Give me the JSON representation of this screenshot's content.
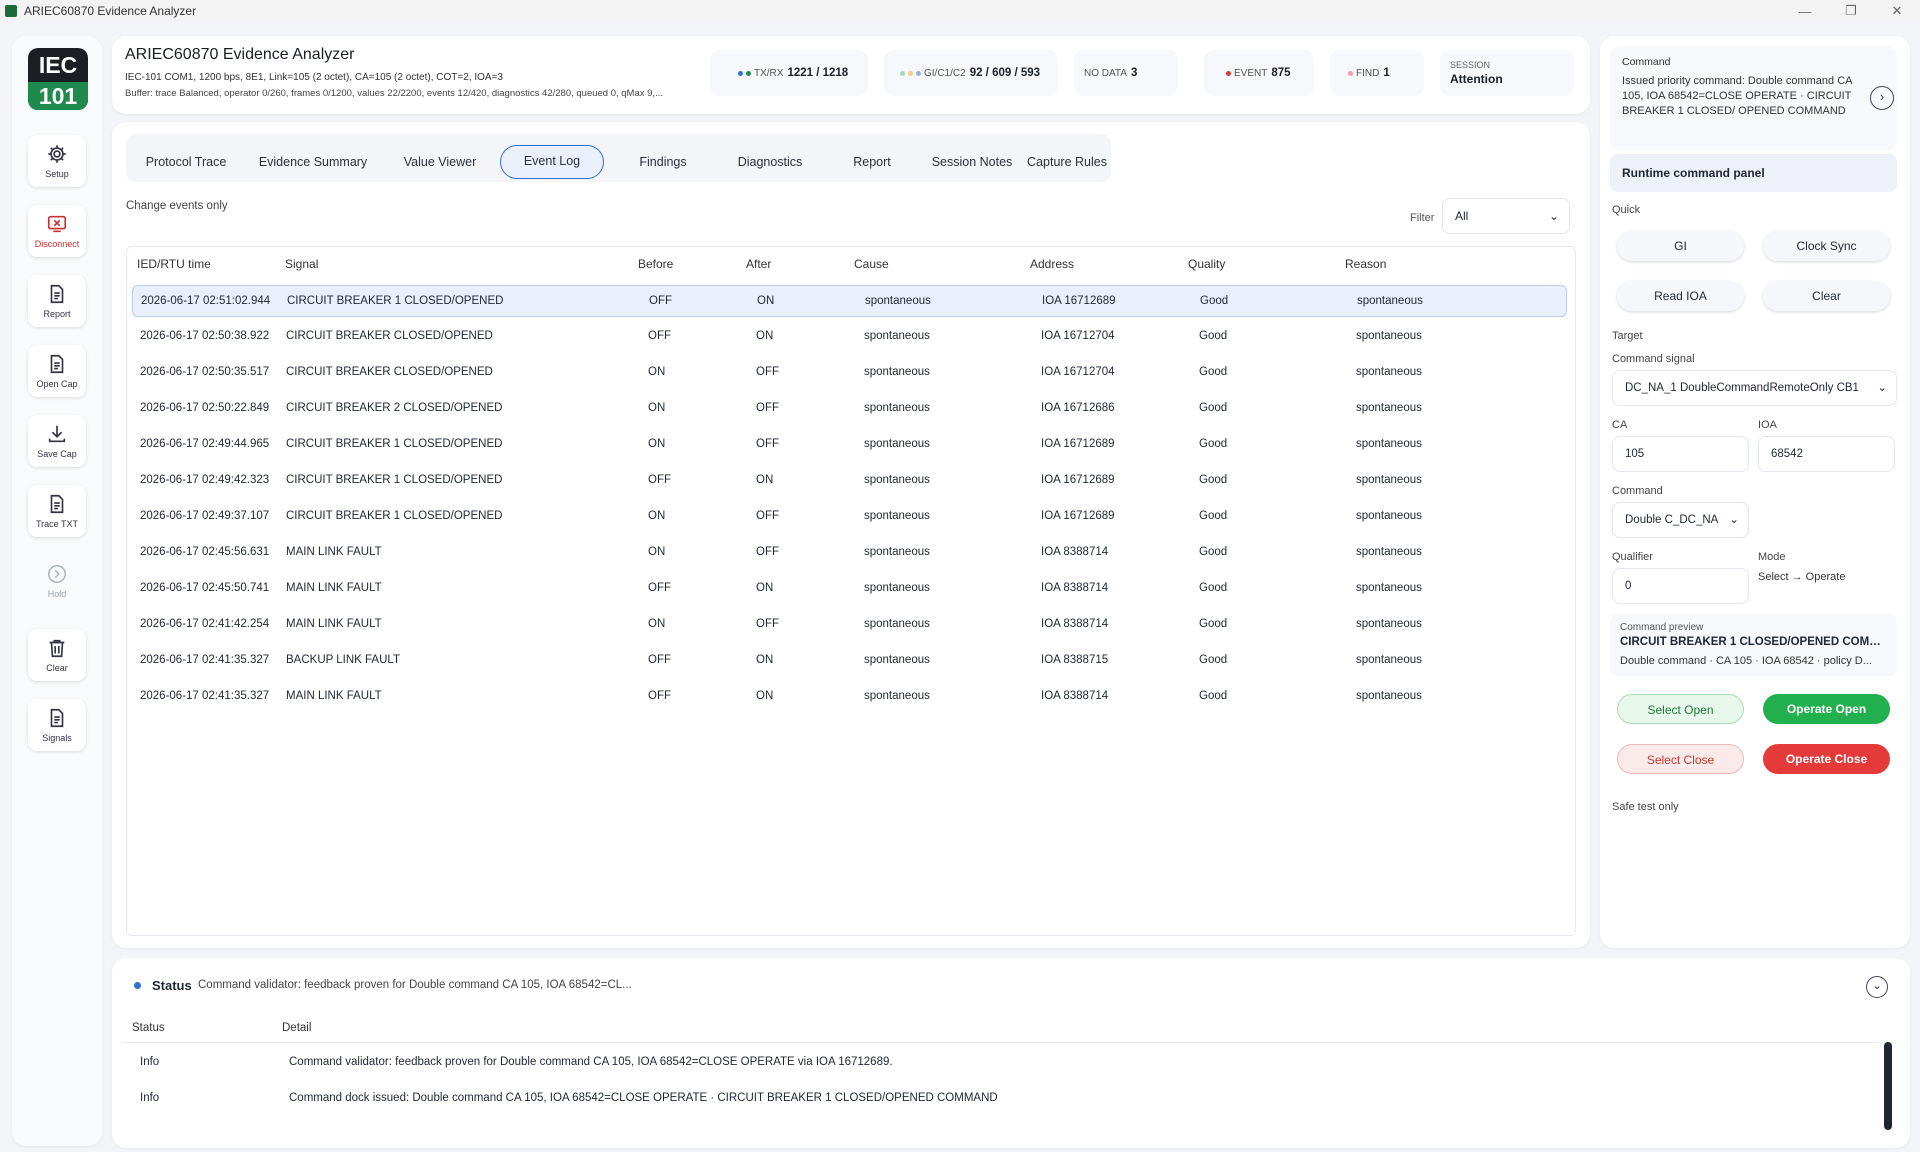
{
  "window": {
    "title": "ARIEC60870 Evidence Analyzer"
  },
  "rail": {
    "logo_top": "IEC",
    "logo_bottom": "101",
    "items": [
      {
        "label": "Setup",
        "icon": "gear-icon"
      },
      {
        "label": "Disconnect",
        "icon": "disconnect-icon"
      },
      {
        "label": "Report",
        "icon": "document-icon"
      },
      {
        "label": "Open Cap",
        "icon": "document-icon"
      },
      {
        "label": "Save Cap",
        "icon": "download-icon"
      },
      {
        "label": "Trace TXT",
        "icon": "document-icon"
      },
      {
        "label": "Hold",
        "icon": "chevron-right-icon"
      },
      {
        "label": "Clear",
        "icon": "trash-icon"
      },
      {
        "label": "Signals",
        "icon": "document-icon"
      }
    ]
  },
  "header": {
    "title": "ARIEC60870 Evidence Analyzer",
    "line1": "IEC-101 COM1, 1200 bps, 8E1, Link=105 (2 octet), CA=105 (2 octet), COT=2, IOA=3",
    "line2": "Buffer: trace Balanced, operator 0/260, frames 0/1200, values 22/2200, events 12/420, diagnostics 42/280, queued 0, qMax 9,...",
    "txrx_label": "TX/RX",
    "txrx_value": "1221 / 1218",
    "gi_label": "GI/C1/C2",
    "gi_value": "92 / 609 / 593",
    "nodata_label": "NO DATA",
    "nodata_value": "3",
    "event_label": "EVENT",
    "event_value": "875",
    "find_label": "FIND",
    "find_value": "1",
    "session_label": "SESSION",
    "session_value": "Attention"
  },
  "tabs": [
    "Protocol Trace",
    "Evidence Summary",
    "Value Viewer",
    "Event Log",
    "Findings",
    "Diagnostics",
    "Report",
    "Session Notes",
    "Capture Rules"
  ],
  "active_tab": "Event Log",
  "event_log": {
    "subtitle": "Change events only",
    "filter_label": "Filter",
    "filter_value": "All",
    "columns": [
      "IED/RTU time",
      "Signal",
      "Before",
      "After",
      "Cause",
      "Address",
      "Quality",
      "Reason"
    ],
    "rows": [
      [
        "2026-06-17 02:51:02.944",
        "CIRCUIT BREAKER 1 CLOSED/OPENED",
        "OFF",
        "ON",
        "spontaneous",
        "IOA 16712689",
        "Good",
        "spontaneous"
      ],
      [
        "2026-06-17 02:50:38.922",
        "CIRCUIT BREAKER CLOSED/OPENED",
        "OFF",
        "ON",
        "spontaneous",
        "IOA 16712704",
        "Good",
        "spontaneous"
      ],
      [
        "2026-06-17 02:50:35.517",
        "CIRCUIT BREAKER CLOSED/OPENED",
        "ON",
        "OFF",
        "spontaneous",
        "IOA 16712704",
        "Good",
        "spontaneous"
      ],
      [
        "2026-06-17 02:50:22.849",
        "CIRCUIT BREAKER 2 CLOSED/OPENED",
        "ON",
        "OFF",
        "spontaneous",
        "IOA 16712686",
        "Good",
        "spontaneous"
      ],
      [
        "2026-06-17 02:49:44.965",
        "CIRCUIT BREAKER 1 CLOSED/OPENED",
        "ON",
        "OFF",
        "spontaneous",
        "IOA 16712689",
        "Good",
        "spontaneous"
      ],
      [
        "2026-06-17 02:49:42.323",
        "CIRCUIT BREAKER 1 CLOSED/OPENED",
        "OFF",
        "ON",
        "spontaneous",
        "IOA 16712689",
        "Good",
        "spontaneous"
      ],
      [
        "2026-06-17 02:49:37.107",
        "CIRCUIT BREAKER 1 CLOSED/OPENED",
        "ON",
        "OFF",
        "spontaneous",
        "IOA 16712689",
        "Good",
        "spontaneous"
      ],
      [
        "2026-06-17 02:45:56.631",
        "MAIN LINK FAULT",
        "ON",
        "OFF",
        "spontaneous",
        "IOA 8388714",
        "Good",
        "spontaneous"
      ],
      [
        "2026-06-17 02:45:50.741",
        "MAIN LINK FAULT",
        "OFF",
        "ON",
        "spontaneous",
        "IOA 8388714",
        "Good",
        "spontaneous"
      ],
      [
        "2026-06-17 02:41:42.254",
        "MAIN LINK FAULT",
        "ON",
        "OFF",
        "spontaneous",
        "IOA 8388714",
        "Good",
        "spontaneous"
      ],
      [
        "2026-06-17 02:41:35.327",
        "BACKUP LINK FAULT",
        "OFF",
        "ON",
        "spontaneous",
        "IOA 8388715",
        "Good",
        "spontaneous"
      ],
      [
        "2026-06-17 02:41:35.327",
        "MAIN LINK FAULT",
        "OFF",
        "ON",
        "spontaneous",
        "IOA 8388714",
        "Good",
        "spontaneous"
      ]
    ]
  },
  "command_panel": {
    "card_label": "Command",
    "card_text": "Issued priority command: Double command CA 105, IOA 68542=CLOSE OPERATE · CIRCUIT BREAKER 1 CLOSED/ OPENED COMMAND",
    "runtime_label": "Runtime command panel",
    "quick_label": "Quick",
    "quick": [
      "GI",
      "Clock Sync",
      "Read IOA",
      "Clear"
    ],
    "target_label": "Target",
    "signal_label": "Command signal",
    "signal_value": "DC_NA_1 DoubleCommandRemoteOnly CB1",
    "ca_label": "CA",
    "ca_value": "105",
    "ioa_label": "IOA",
    "ioa_value": "68542",
    "command_label": "Command",
    "command_value": "Double C_DC_NA",
    "qualifier_label": "Qualifier",
    "qualifier_value": "0",
    "mode_label": "Mode",
    "mode_value": "Select → Operate",
    "preview_label": "Command preview",
    "preview_title": "CIRCUIT BREAKER 1 CLOSED/OPENED COMMA...",
    "preview_detail": "Double command · CA 105 · IOA 68542 · policy D...",
    "select_open": "Select Open",
    "operate_open": "Operate Open",
    "select_close": "Select Close",
    "operate_close": "Operate Close",
    "safe_note": "Safe test only"
  },
  "status": {
    "title": "Status",
    "summary": "Command validator: feedback proven for Double command CA 105, IOA 68542=CL...",
    "columns": [
      "Status",
      "Detail"
    ],
    "rows": [
      [
        "Info",
        "Command validator: feedback proven for Double command CA 105, IOA 68542=CLOSE OPERATE via IOA 16712689."
      ],
      [
        "Info",
        "Command dock issued: Double command CA 105, IOA 68542=CLOSE OPERATE · CIRCUIT BREAKER 1 CLOSED/OPENED COMMAND"
      ]
    ]
  }
}
